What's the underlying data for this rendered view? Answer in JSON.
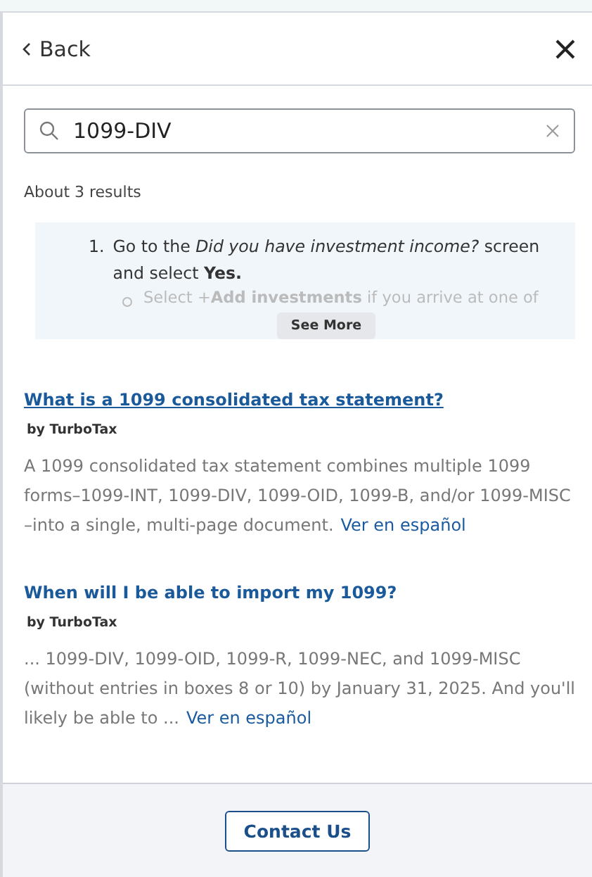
{
  "header": {
    "back_label": "Back"
  },
  "search": {
    "value": "1099-DIV"
  },
  "result_count": "About 3 results",
  "snippet": {
    "number": "1.",
    "text": "Go to the *Did you have investment income?* screen and select **Yes.**",
    "sub_bullet": "Select +**Add investments** if you arrive at one of",
    "button": "See More"
  },
  "results": [
    {
      "title": "What is a 1099 consolidated tax statement?",
      "hovered": true,
      "author": "by TurboTax",
      "summary": "A 1099 consolidated tax statement combines multiple 1099 forms–1099-INT, 1099-DIV, 1099-OID, 1099-B, and/or 1099-MISC –into a single, multi-page document.",
      "link": "Ver en español"
    },
    {
      "title": "When will I be able to import my 1099?",
      "hovered": false,
      "author": "by TurboTax",
      "summary": "... 1099-DIV, 1099-OID, 1099-R, 1099-NEC, and 1099-MISC (without entries in boxes 8 or 10) by January 31, 2025. And you'll likely be able to ...",
      "link": "Ver en español"
    }
  ],
  "footer": {
    "button": "Contact Us"
  }
}
